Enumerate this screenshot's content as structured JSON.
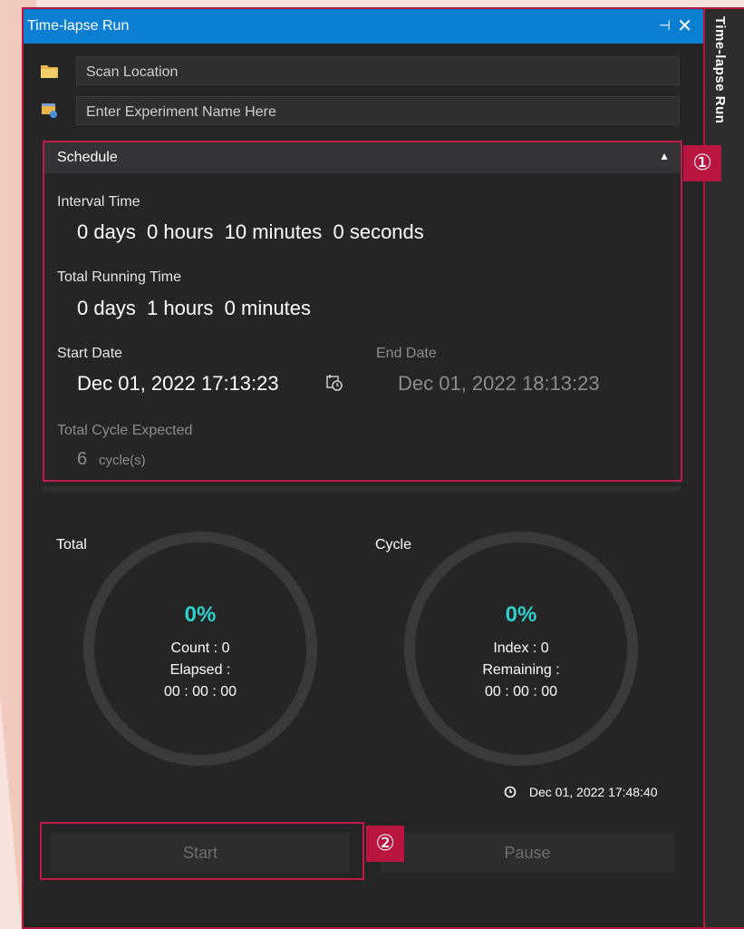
{
  "window": {
    "title": "Time-lapse Run",
    "side_tab_label": "Time-lapse Run",
    "pin_glyph": "⊣",
    "close_glyph": "✕"
  },
  "fields": {
    "scan_location_placeholder": "Scan Location",
    "experiment_name_placeholder": "Enter Experiment Name Here"
  },
  "schedule": {
    "header": "Schedule",
    "interval_label": "Interval Time",
    "interval_value": "0 days  0 hours  10 minutes  0 seconds",
    "total_running_label": "Total Running Time",
    "total_running_value": "0 days  1 hours  0 minutes",
    "start_date_label": "Start Date",
    "start_date_value": "Dec 01, 2022 17:13:23",
    "end_date_label": "End Date",
    "end_date_value": "Dec 01, 2022 18:13:23",
    "total_cycle_label": "Total Cycle Expected",
    "total_cycle_count": "6",
    "total_cycle_unit": "cycle(s)"
  },
  "badges": {
    "one": "①",
    "two": "②"
  },
  "progress": {
    "total": {
      "label": "Total",
      "percent_text": "0%",
      "count_text": "Count : 0",
      "elapsed_label": "Elapsed :",
      "elapsed_time": "00 : 00 : 00"
    },
    "cycle": {
      "label": "Cycle",
      "percent_text": "0%",
      "index_text": "Index : 0",
      "remaining_label": "Remaining :",
      "remaining_time": "00 : 00 : 00"
    },
    "percent_color": "#2dd0cc"
  },
  "clock": {
    "timestamp": "Dec 01, 2022 17:48:40"
  },
  "buttons": {
    "start": "Start",
    "pause": "Pause"
  },
  "colors": {
    "titlebar": "#0c7fd3",
    "highlight": "#c21a47",
    "panel": "#252526"
  }
}
